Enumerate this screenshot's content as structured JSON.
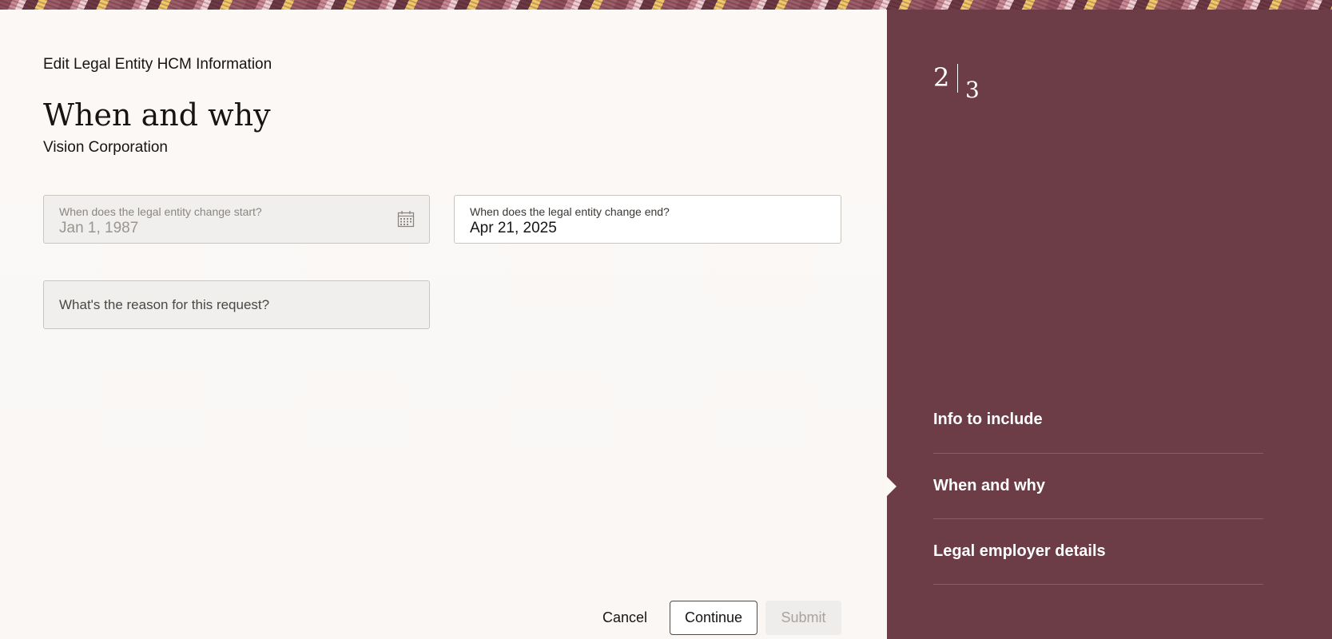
{
  "header": {
    "page_header": "Edit Legal Entity HCM Information",
    "title": "When and why",
    "subtitle": "Vision Corporation"
  },
  "form": {
    "start": {
      "label": "When does the legal entity change start?",
      "value": "Jan 1, 1987",
      "icon": "calendar-icon",
      "disabled": true
    },
    "end": {
      "label": "When does the legal entity change end?",
      "value": "Apr 21, 2025"
    },
    "reason": {
      "placeholder": "What's the reason for this request?"
    }
  },
  "actions": {
    "cancel": "Cancel",
    "continue": "Continue",
    "submit": "Submit"
  },
  "sidebar": {
    "current_step": "2",
    "total_steps": "3",
    "steps": [
      {
        "label": "Info to include",
        "active": false
      },
      {
        "label": "When and why",
        "active": true
      },
      {
        "label": "Legal employer details",
        "active": false
      }
    ]
  },
  "colors": {
    "sidebar_bg": "#6c3c47",
    "page_bg": "#fbf8f6",
    "border": "#c9c5c1"
  }
}
